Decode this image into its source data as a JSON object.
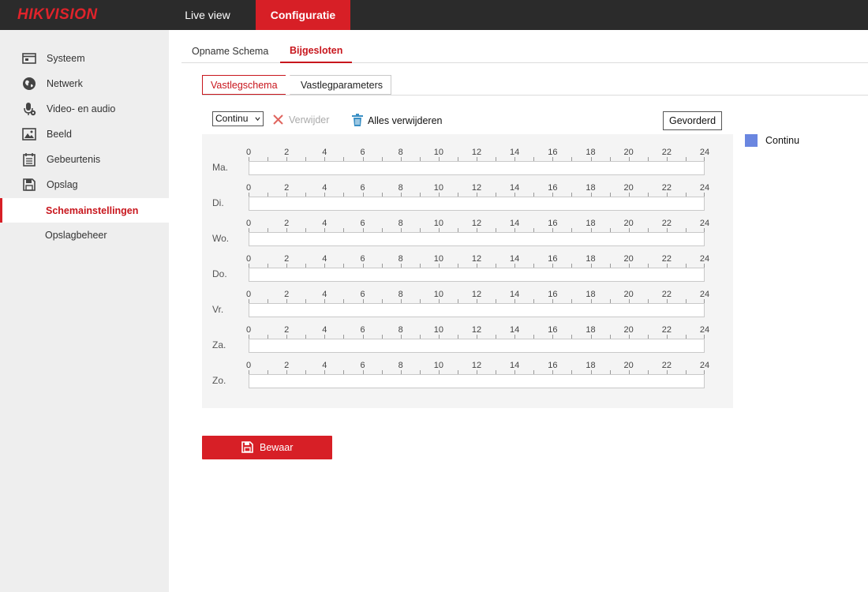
{
  "brand": {
    "logo": "HIKVISION",
    "accent_color": "#d71f26",
    "legend_color": "#6a86e0"
  },
  "topnav": {
    "live_view": "Live view",
    "configuration": "Configuratie"
  },
  "sidebar": {
    "items": [
      {
        "label": "Systeem",
        "icon": "monitor-icon"
      },
      {
        "label": "Netwerk",
        "icon": "globe-icon"
      },
      {
        "label": "Video- en audio",
        "icon": "microphone-icon"
      },
      {
        "label": "Beeld",
        "icon": "image-icon"
      },
      {
        "label": "Gebeurtenis",
        "icon": "calendar-icon"
      },
      {
        "label": "Opslag",
        "icon": "floppy-disk-icon"
      }
    ],
    "subitems": [
      {
        "label": "Schemainstellingen",
        "active": true
      },
      {
        "label": "Opslagbeheer",
        "active": false
      }
    ]
  },
  "tabs": [
    {
      "label": "Opname Schema",
      "active": false
    },
    {
      "label": "Bijgesloten",
      "active": true
    }
  ],
  "subtabs": [
    {
      "label": "Vastlegschema",
      "active": true
    },
    {
      "label": "Vastlegparameters",
      "active": false
    }
  ],
  "toolbar": {
    "mode_value": "Continu",
    "delete_label": "Verwijder",
    "delete_all_label": "Alles verwijderen",
    "advanced_label": "Gevorderd"
  },
  "legend": {
    "label": "Continu"
  },
  "schedule": {
    "hours": [
      "0",
      "2",
      "4",
      "6",
      "8",
      "10",
      "12",
      "14",
      "16",
      "18",
      "20",
      "22",
      "24"
    ],
    "days": [
      "Ma.",
      "Di.",
      "Wo.",
      "Do.",
      "Vr.",
      "Za.",
      "Zo."
    ]
  },
  "save_label": "Bewaar"
}
